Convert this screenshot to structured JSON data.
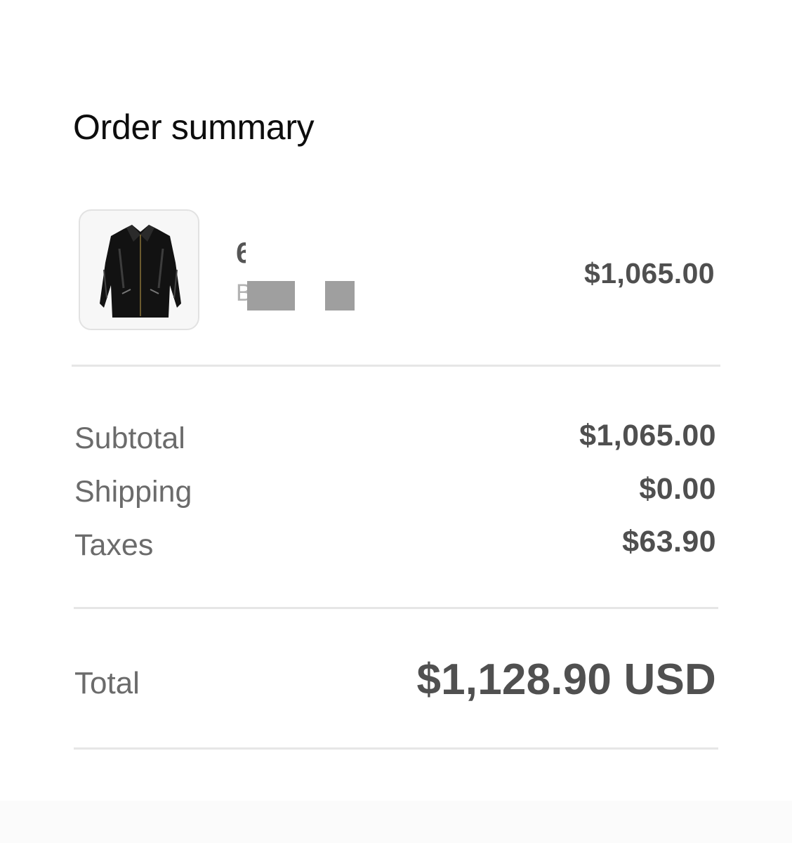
{
  "order_summary": {
    "title": "Order summary"
  },
  "line_item": {
    "name_partial": "6",
    "variant_partial": "B",
    "price": "$1,065.00",
    "thumbnail_icon": "leather-jacket-icon"
  },
  "costs": {
    "subtotal_label": "Subtotal",
    "subtotal_value": "$1,065.00",
    "shipping_label": "Shipping",
    "shipping_value": "$0.00",
    "taxes_label": "Taxes",
    "taxes_value": "$63.90",
    "total_label": "Total",
    "total_value": "$1,128.90 USD"
  }
}
